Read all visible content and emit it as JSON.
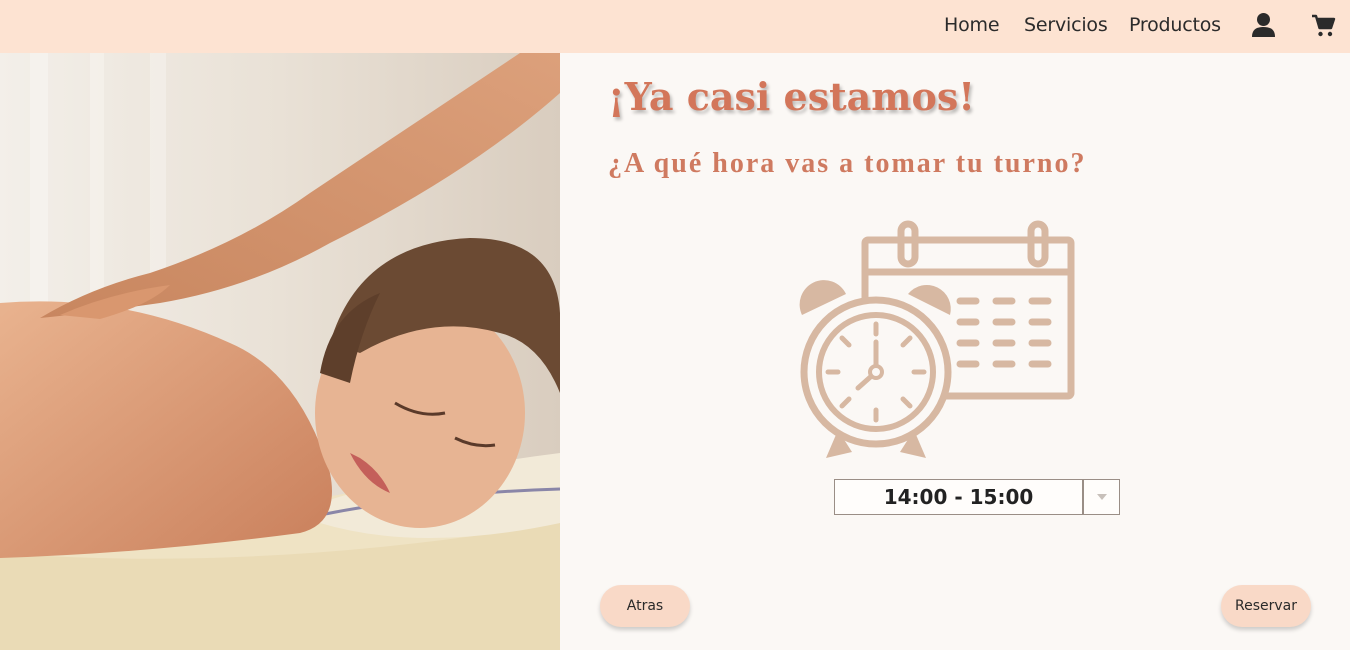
{
  "nav": {
    "items": [
      {
        "label": "Home"
      },
      {
        "label": "Servicios"
      },
      {
        "label": "Productos"
      }
    ],
    "user_icon": "user-icon",
    "cart_icon": "shopping-cart-icon"
  },
  "main": {
    "title": "¡Ya casi estamos!",
    "subtitle": "¿A qué hora vas a tomar tu turno?",
    "illustration": "alarm-clock-calendar-icon",
    "time_select": {
      "value": "14:00 - 15:00"
    },
    "back_label": "Atras",
    "reserve_label": "Reservar"
  },
  "colors": {
    "topbar": "#fde3d2",
    "accent": "#d3765a",
    "button": "#f9d9c7",
    "illustration": "#d7b8a2"
  }
}
